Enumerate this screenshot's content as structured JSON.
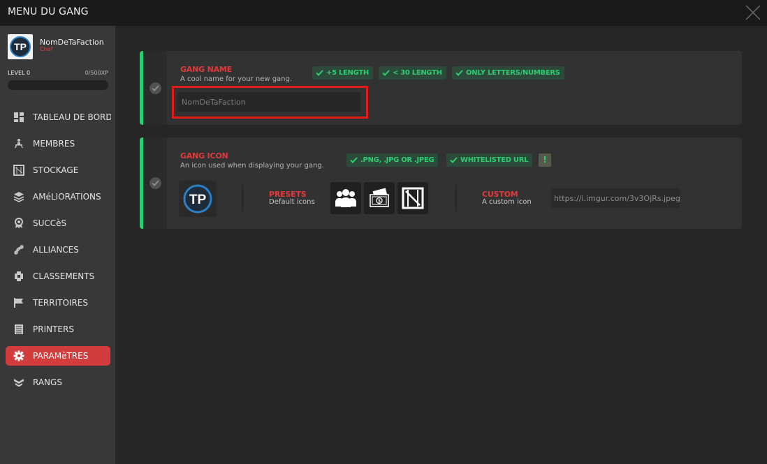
{
  "window": {
    "title": "MENU DU GANG"
  },
  "profile": {
    "name": "NomDeTaFaction",
    "role": "Chef",
    "avatar_text": "TP",
    "level_label": "LEVEL 0",
    "xp_label": "0/500XP",
    "xp_progress": 0
  },
  "nav": {
    "items": [
      {
        "label": "TABLEAU DE BORD",
        "icon": "dashboard-icon"
      },
      {
        "label": "MEMBRES",
        "icon": "members-icon"
      },
      {
        "label": "STOCKAGE",
        "icon": "storage-icon"
      },
      {
        "label": "AMéLIORATIONS",
        "icon": "upgrades-icon"
      },
      {
        "label": "SUCCèS",
        "icon": "achievements-icon"
      },
      {
        "label": "ALLIANCES",
        "icon": "alliances-icon"
      },
      {
        "label": "CLASSEMENTS",
        "icon": "rankings-icon"
      },
      {
        "label": "TERRITOIRES",
        "icon": "flag-icon"
      },
      {
        "label": "PRINTERS",
        "icon": "printer-icon"
      },
      {
        "label": "PARAMèTRES",
        "icon": "gear-icon",
        "active": true
      },
      {
        "label": "RANGS",
        "icon": "ranks-icon"
      }
    ]
  },
  "gang_name": {
    "title": "GANG NAME",
    "description": "A cool name for your new gang.",
    "tags": [
      "+5 LENGTH",
      "< 30 LENGTH",
      "ONLY LETTERS/NUMBERS"
    ],
    "placeholder": "NomDeTaFaction"
  },
  "gang_icon": {
    "title": "GANG ICON",
    "description": "An icon used when displaying your gang.",
    "tags": [
      ".PNG, .JPG OR .JPEG",
      "WHITELISTED URL"
    ],
    "warning": "!",
    "presets_title": "PRESETS",
    "presets_desc": "Default icons",
    "preset_icons": [
      "group-icon",
      "money-icon",
      "crate-icon"
    ],
    "custom_title": "CUSTOM",
    "custom_desc": "A custom icon",
    "custom_url": "https://i.imgur.com/3v3OjRs.jpeg"
  },
  "colors": {
    "accent_red": "#e03a3a",
    "accent_green": "#2ecc71",
    "active_nav": "#d23c3c"
  }
}
